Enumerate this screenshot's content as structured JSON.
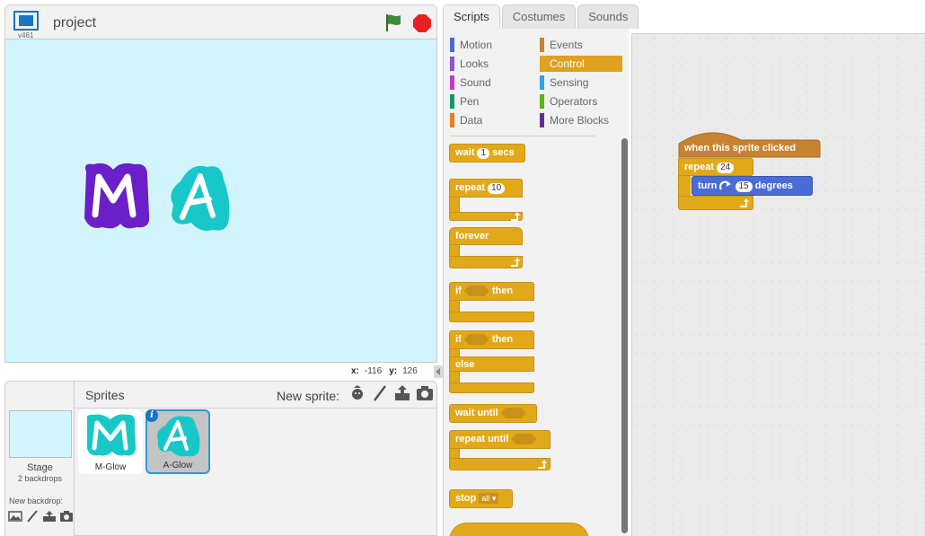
{
  "stage_header": {
    "version": "v461",
    "project_title": "project"
  },
  "stage": {
    "sprite_letters": [
      "M",
      "A"
    ]
  },
  "coords": {
    "x_label": "x:",
    "x_value": "-116",
    "y_label": "y:",
    "y_value": "126"
  },
  "sprites_panel": {
    "title": "Sprites",
    "new_sprite_label": "New sprite:",
    "stage_label": "Stage",
    "stage_sub": "2 backdrops",
    "new_backdrop_label": "New backdrop:",
    "sprites": [
      {
        "name": "M-Glow",
        "letter": "M"
      },
      {
        "name": "A-Glow",
        "letter": "A"
      }
    ],
    "info_badge": "i"
  },
  "tabs": [
    "Scripts",
    "Costumes",
    "Sounds"
  ],
  "categories": [
    {
      "label": "Motion",
      "color": "#4a6cd4"
    },
    {
      "label": "Events",
      "color": "#c88330"
    },
    {
      "label": "Looks",
      "color": "#8a55d7"
    },
    {
      "label": "Control",
      "color": "#e1a91a"
    },
    {
      "label": "Sound",
      "color": "#bb42c3"
    },
    {
      "label": "Sensing",
      "color": "#2ca5e2"
    },
    {
      "label": "Pen",
      "color": "#0e9a6c"
    },
    {
      "label": "Operators",
      "color": "#5cb712"
    },
    {
      "label": "Data",
      "color": "#ee7d16"
    },
    {
      "label": "More Blocks",
      "color": "#632d99"
    }
  ],
  "palette_blocks": {
    "wait": "wait",
    "wait_val": "1",
    "secs": "secs",
    "repeat": "repeat",
    "repeat_val": "10",
    "forever": "forever",
    "if": "if",
    "then": "then",
    "if2": "if",
    "then2": "then",
    "else": "else",
    "wait_until": "wait until",
    "repeat_until": "repeat until",
    "stop": "stop",
    "stop_val": "all"
  },
  "script": {
    "hat": "when this sprite clicked",
    "repeat": "repeat",
    "repeat_val": "24",
    "turn": "turn",
    "turn_val": "15",
    "degrees": "degrees"
  },
  "colors": {
    "control": "#e1a91a",
    "events": "#c88330",
    "motion": "#4a6cd4",
    "stage_bg": "#d2f5fd",
    "selected_border": "#2c9ad8"
  }
}
